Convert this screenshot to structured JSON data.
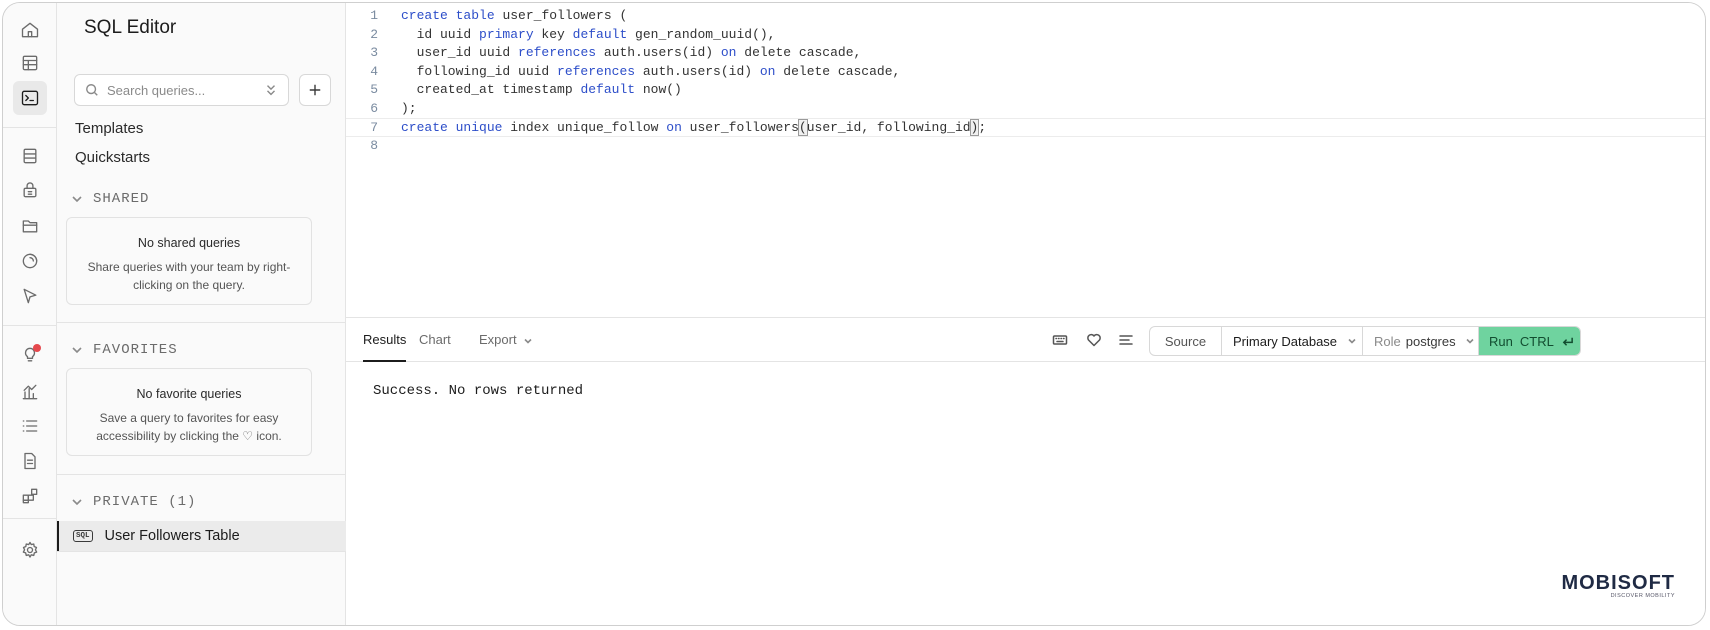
{
  "sidebar": {
    "title": "SQL Editor",
    "search_placeholder": "Search queries...",
    "links": [
      "Templates",
      "Quickstarts"
    ],
    "shared": {
      "heading": "SHARED",
      "empty_title": "No shared queries",
      "empty_desc": "Share queries with your team by right-clicking on the query."
    },
    "favorites": {
      "heading": "FAVORITES",
      "empty_title": "No favorite queries",
      "empty_desc": "Save a query to favorites for easy accessibility by clicking the ♡ icon."
    },
    "private": {
      "heading": "PRIVATE (1)",
      "items": [
        {
          "chip": "SQL",
          "label": "User Followers Table"
        }
      ]
    }
  },
  "editor": {
    "line_numbers": [
      "1",
      "2",
      "3",
      "4",
      "5",
      "6",
      "7",
      "8"
    ],
    "current_line": 7,
    "code": [
      "create table user_followers (",
      "  id uuid primary key default gen_random_uuid(),",
      "  user_id uuid references auth.users(id) on delete cascade,",
      "  following_id uuid references auth.users(id) on delete cascade,",
      "  created_at timestamp default now()",
      ");",
      "create unique index unique_follow on user_followers(user_id, following_id);",
      ""
    ]
  },
  "results": {
    "tabs": [
      "Results",
      "Chart",
      "Export"
    ],
    "active_tab": "Results",
    "source_label": "Source",
    "database": "Primary Database",
    "role_label": "Role",
    "role_value": "postgres",
    "run_label": "Run",
    "run_shortcut": "CTRL",
    "message": "Success. No rows returned"
  },
  "watermark": {
    "brand": "MOBISOFT",
    "tagline": "DISCOVER MOBILITY"
  },
  "colors": {
    "run_button": "#6fd39f",
    "keyword": "#2d4ec9",
    "badge": "#e5484d"
  },
  "icons": {
    "rail": [
      "home-icon",
      "table-editor-icon",
      "sql-editor-icon",
      "database-icon",
      "auth-lock-icon",
      "storage-icon",
      "realtime-icon",
      "edge-functions-icon",
      "advisors-icon",
      "reports-icon",
      "logs-icon",
      "api-docs-icon",
      "integrations-icon",
      "settings-gear-icon"
    ]
  }
}
